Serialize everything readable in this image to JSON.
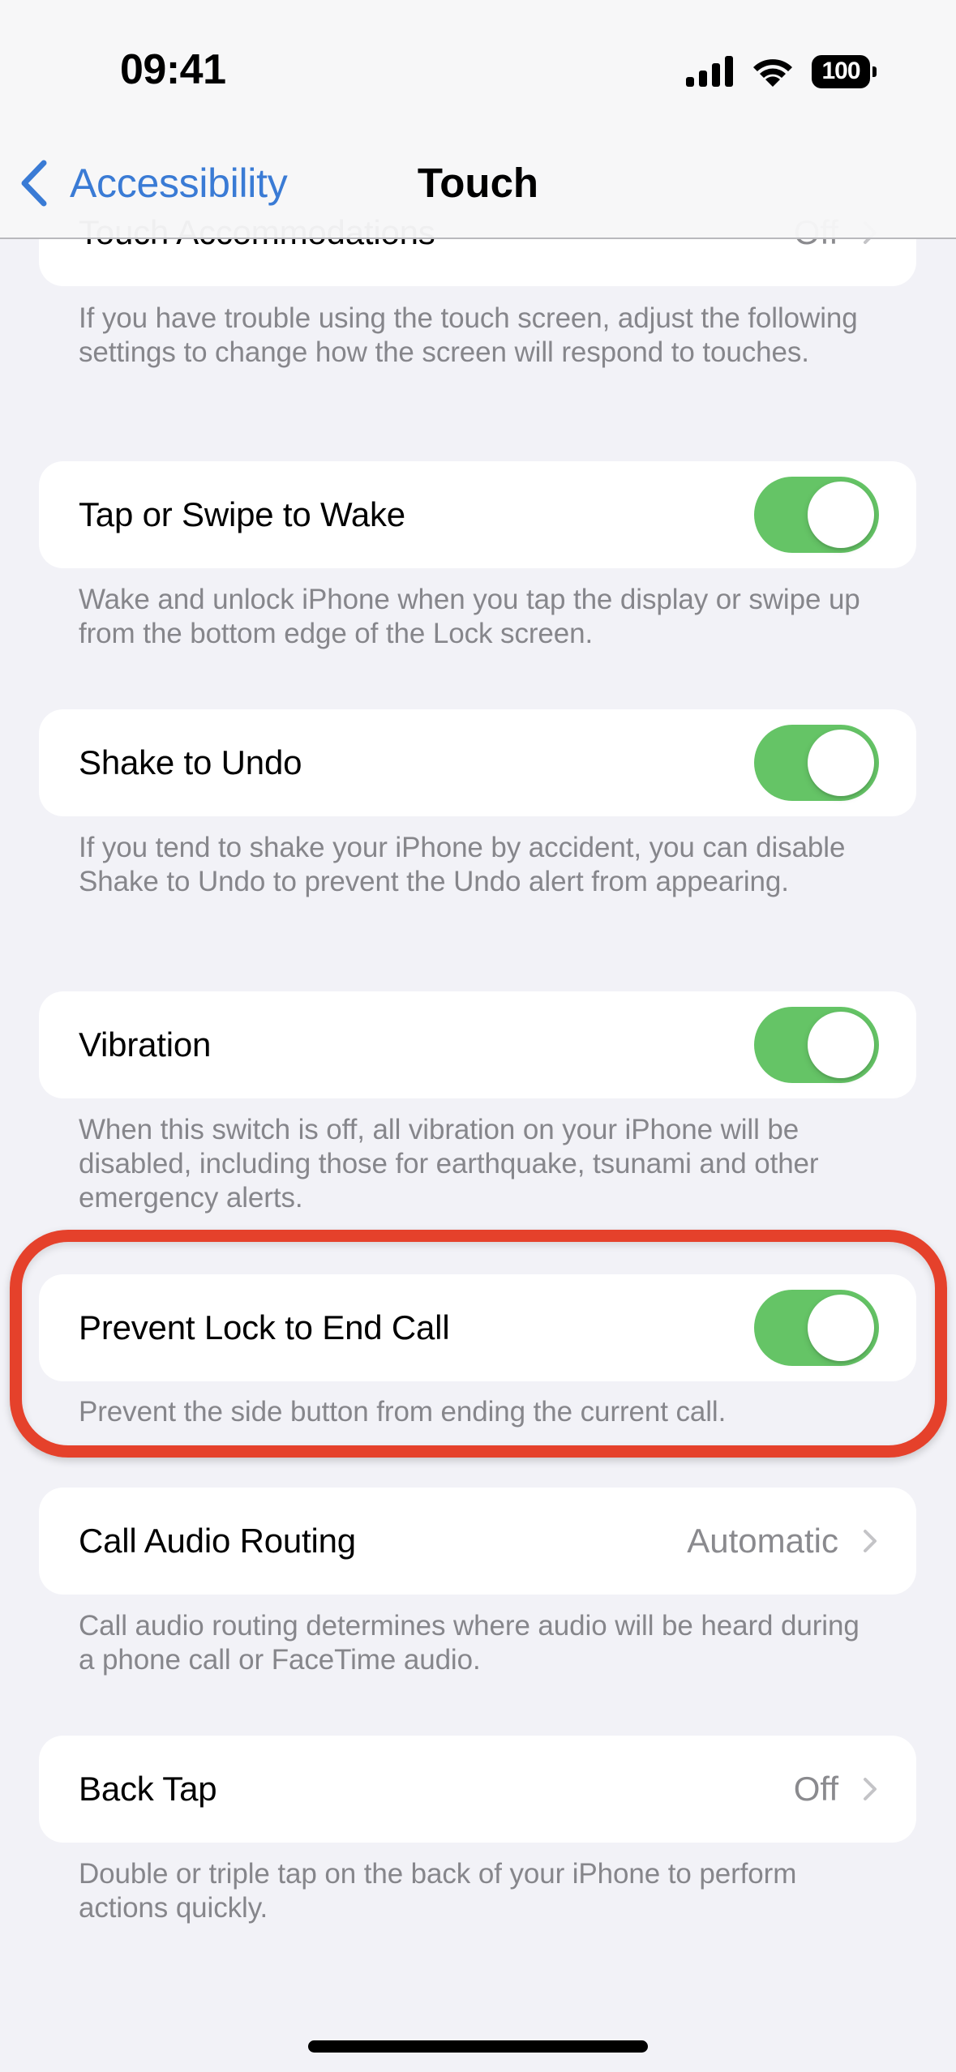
{
  "status_bar": {
    "time": "09:41",
    "battery_level": "100",
    "icons": [
      "signal-icon",
      "wifi-icon",
      "battery-icon"
    ]
  },
  "nav": {
    "back_label": "Accessibility",
    "back_icon": "chevron-left-icon",
    "title": "Touch"
  },
  "colors": {
    "accent": "#3a7bd5",
    "toggle_on": "#65c466",
    "highlight": "#e5412b",
    "background": "#f2f2f7"
  },
  "sections": [
    {
      "label": "Touch Accommodations",
      "value": "Off",
      "type": "disclosure",
      "footer": "If you have trouble using the touch screen, adjust the following settings to change how the screen will respond to touches."
    },
    {
      "label": "Tap or Swipe to Wake",
      "type": "toggle",
      "on": true,
      "footer": "Wake and unlock iPhone when you tap the display or swipe up from the bottom edge of the Lock screen."
    },
    {
      "label": "Shake to Undo",
      "type": "toggle",
      "on": true,
      "footer": "If you tend to shake your iPhone by accident, you can disable Shake to Undo to prevent the Undo alert from appearing."
    },
    {
      "label": "Vibration",
      "type": "toggle",
      "on": true,
      "footer": "When this switch is off, all vibration on your iPhone will be disabled, including those for earthquake, tsunami and other emergency alerts."
    },
    {
      "label": "Prevent Lock to End Call",
      "type": "toggle",
      "on": true,
      "highlighted": true,
      "footer": "Prevent the side button from ending the current call."
    },
    {
      "label": "Call Audio Routing",
      "value": "Automatic",
      "type": "disclosure",
      "footer": "Call audio routing determines where audio will be heard during a phone call or FaceTime audio."
    },
    {
      "label": "Back Tap",
      "value": "Off",
      "type": "disclosure",
      "footer": "Double or triple tap on the back of your iPhone to perform actions quickly."
    }
  ]
}
